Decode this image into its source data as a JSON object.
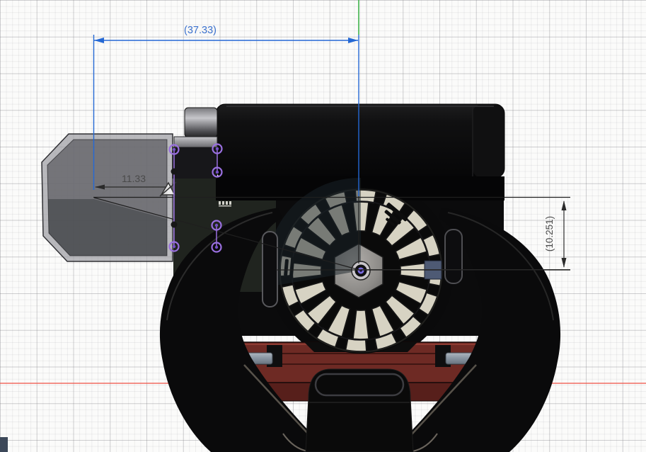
{
  "viewport": {
    "type": "cad-3d-orthographic-view",
    "grid_visible": true,
    "axes": {
      "x_axis_color": "#f05044",
      "y_axis_color": "#3fb34a"
    }
  },
  "dimensions": {
    "overall_width": {
      "label": "(37.33)",
      "color": "#3b71cd",
      "driven": true
    },
    "offset_width": {
      "label": "11.33",
      "color": "#4a4a4a"
    },
    "right_height": {
      "label": "(10.251)",
      "color": "#4a4a4a",
      "driven": true
    }
  },
  "model": {
    "description": "small engine assembly with cooling fan, fuel tank, muffler box, carry handles and red mounting base",
    "fan_blade_count": 16,
    "accent_colors": {
      "dimension_blue": "#2468d4",
      "sketch_point_purple": "#9a70e0",
      "mount_red": "#6e2a24",
      "pad_gray_blue": "#8793a0",
      "fan_blade_cream": "#d7d3c3"
    }
  },
  "ui": {
    "bottom_left_panel_color": "#3c4859"
  }
}
